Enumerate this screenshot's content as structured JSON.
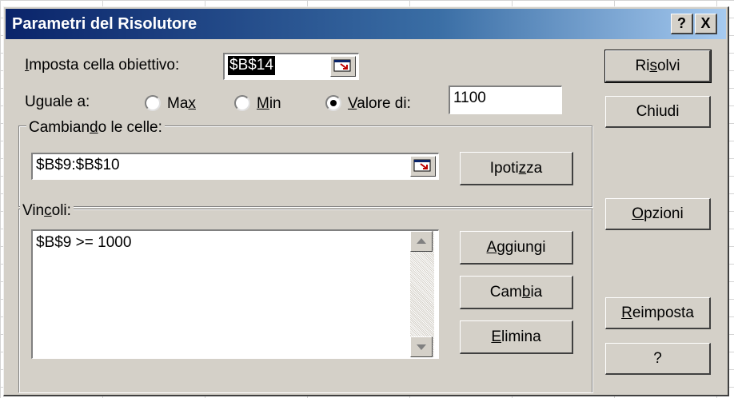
{
  "window": {
    "title": "Parametri del Risolutore"
  },
  "titlebar": {
    "help_label": "?",
    "close_label": "X"
  },
  "target": {
    "label_pre": "",
    "label_u": "I",
    "label_post": "mposta cella obiettivo:",
    "value": "$B$14"
  },
  "equal": {
    "label": "Uguale a:",
    "max": {
      "pre": "Ma",
      "u": "x",
      "post": ""
    },
    "min": {
      "pre": "",
      "u": "M",
      "post": "in"
    },
    "valore": {
      "pre": "",
      "u": "V",
      "post": "alore di:"
    },
    "value": "1100",
    "selected": "valore"
  },
  "changing": {
    "label_pre": "Cambian",
    "label_u": "d",
    "label_post": "o le celle:",
    "value": "$B$9:$B$10",
    "guess": {
      "pre": "Ipoti",
      "u": "z",
      "post": "za"
    }
  },
  "constraints": {
    "label_pre": "Vin",
    "label_u": "c",
    "label_post": "oli:",
    "items": [
      "$B$9 >= 1000"
    ],
    "add": {
      "pre": "",
      "u": "A",
      "post": "ggiungi"
    },
    "change": {
      "pre": "Cam",
      "u": "b",
      "post": "ia"
    },
    "delete": {
      "pre": "",
      "u": "E",
      "post": "limina"
    }
  },
  "side": {
    "solve": {
      "pre": "Ri",
      "u": "s",
      "post": "olvi"
    },
    "close": "Chiudi",
    "options": {
      "pre": "",
      "u": "O",
      "post": "pzioni"
    },
    "reset": {
      "pre": "",
      "u": "R",
      "post": "eimposta"
    },
    "help": "?"
  },
  "colors": {
    "title_start": "#0a246a",
    "title_end": "#a6caf0",
    "face": "#d4d0c8",
    "selection": "#000000"
  }
}
